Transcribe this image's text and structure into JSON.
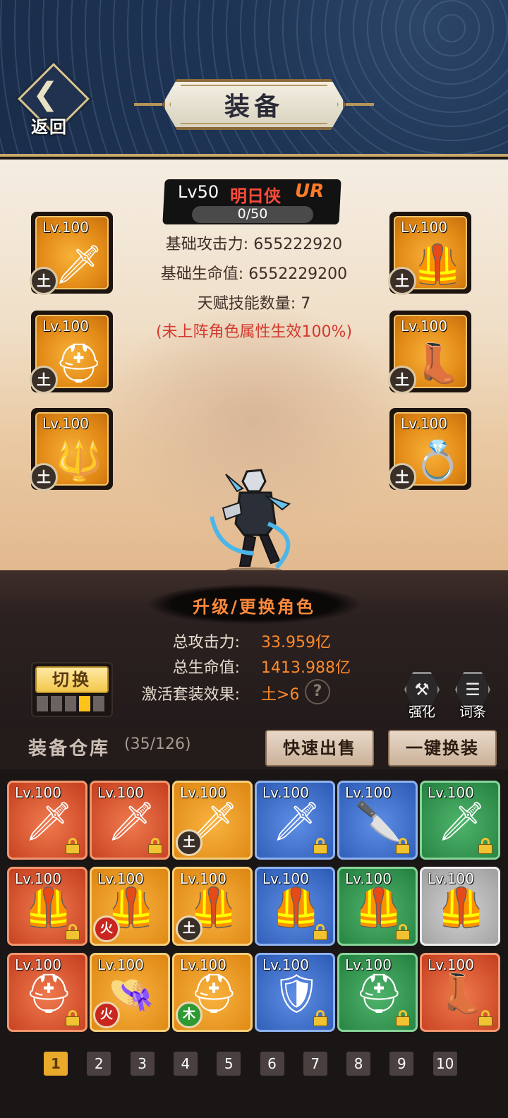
{
  "header": {
    "back_label": "返回",
    "title": "装备"
  },
  "hero": {
    "level": "Lv50",
    "name": "明日侠",
    "rank": "UR",
    "xp": "0/50",
    "progress": 0,
    "stats": [
      "基础攻击力: 655222920",
      "基础生命值: 6552229200",
      "天赋技能数量: 7"
    ],
    "note": "(未上阵角色属性生效100%)"
  },
  "equipped": [
    {
      "lv": "Lv.100",
      "icon": "golden-sword-icon",
      "glyph": "🗡",
      "element": "土"
    },
    {
      "lv": "Lv.100",
      "icon": "armor-icon",
      "glyph": "🦺",
      "element": "土"
    },
    {
      "lv": "Lv.100",
      "icon": "helmet-icon",
      "glyph": "⛑",
      "element": "土"
    },
    {
      "lv": "Lv.100",
      "icon": "boots-icon",
      "glyph": "👢",
      "element": "土"
    },
    {
      "lv": "Lv.100",
      "icon": "amulet-icon",
      "glyph": "🔱",
      "element": "土"
    },
    {
      "lv": "Lv.100",
      "icon": "ring-icon",
      "glyph": "💍",
      "element": "土"
    }
  ],
  "action_banner": "升级/更换角色",
  "totals": {
    "attack_label": "总攻击力:",
    "attack_value": "33.959亿",
    "hp_label": "总生命值:",
    "hp_value": "1413.988亿",
    "set_label": "激活套装效果:",
    "set_value": "土>6",
    "help": "?"
  },
  "switch": {
    "label": "切换",
    "slots": 5,
    "active_slot": 4
  },
  "side_buttons": {
    "enhance_label": "强化",
    "affix_label": "词条"
  },
  "warehouse": {
    "title": "装备仓库",
    "count": "(35/126)",
    "quick_sell": "快速出售",
    "one_click": "一键换装",
    "items": [
      {
        "lv": "Lv.100",
        "color": "red",
        "icon": "crystal-sword-icon",
        "glyph": "🗡",
        "locked": true,
        "element": ""
      },
      {
        "lv": "Lv.100",
        "color": "red",
        "icon": "dark-sword-icon",
        "glyph": "🗡",
        "locked": true,
        "element": ""
      },
      {
        "lv": "Lv.100",
        "color": "orange",
        "icon": "golden-sword-icon",
        "glyph": "🗡",
        "locked": false,
        "element": "土"
      },
      {
        "lv": "Lv.100",
        "color": "blue",
        "icon": "flame-sword-icon",
        "glyph": "🗡",
        "locked": true,
        "element": ""
      },
      {
        "lv": "Lv.100",
        "color": "blue",
        "icon": "gold-blade-icon",
        "glyph": "🔪",
        "locked": true,
        "element": ""
      },
      {
        "lv": "Lv.100",
        "color": "green",
        "icon": "long-sword-icon",
        "glyph": "🗡",
        "locked": true,
        "element": ""
      },
      {
        "lv": "Lv.100",
        "color": "red",
        "icon": "steel-armor-icon",
        "glyph": "🦺",
        "locked": true,
        "element": ""
      },
      {
        "lv": "Lv.100",
        "color": "orange",
        "icon": "red-armor-icon",
        "glyph": "🦺",
        "locked": false,
        "element": "火"
      },
      {
        "lv": "Lv.100",
        "color": "orange",
        "icon": "ruby-armor-icon",
        "glyph": "🦺",
        "locked": false,
        "element": "土"
      },
      {
        "lv": "Lv.100",
        "color": "blue",
        "icon": "steel-armor-icon",
        "glyph": "🦺",
        "locked": true,
        "element": ""
      },
      {
        "lv": "Lv.100",
        "color": "green",
        "icon": "purple-armor-icon",
        "glyph": "🦺",
        "locked": true,
        "element": ""
      },
      {
        "lv": "Lv.100",
        "color": "gray",
        "icon": "red-armor-icon",
        "glyph": "🦺",
        "locked": false,
        "element": ""
      },
      {
        "lv": "Lv.100",
        "color": "red",
        "icon": "purple-helmet-icon",
        "glyph": "⛑",
        "locked": true,
        "element": ""
      },
      {
        "lv": "Lv.100",
        "color": "orange",
        "icon": "straw-hat-icon",
        "glyph": "👒",
        "locked": false,
        "element": "火"
      },
      {
        "lv": "Lv.100",
        "color": "orange",
        "icon": "golden-helmet-icon",
        "glyph": "⛑",
        "locked": false,
        "element": "木"
      },
      {
        "lv": "Lv.100",
        "color": "blue",
        "icon": "crest-helmet-icon",
        "glyph": "🛡",
        "locked": true,
        "element": ""
      },
      {
        "lv": "Lv.100",
        "color": "green",
        "icon": "pink-helmet-icon",
        "glyph": "⛑",
        "locked": true,
        "element": ""
      },
      {
        "lv": "Lv.100",
        "color": "red",
        "icon": "boots-icon",
        "glyph": "👢",
        "locked": true,
        "element": ""
      }
    ]
  },
  "pagination": {
    "pages": [
      "1",
      "2",
      "3",
      "4",
      "5",
      "6",
      "7",
      "8",
      "9",
      "10"
    ],
    "active": "1"
  },
  "colors": {
    "element_earth": "#3b3028",
    "element_fire": "#c8261e",
    "element_wood": "#2f9a34",
    "accent_orange": "#ff8a2a",
    "rank_ur": "#ff7b2a"
  }
}
